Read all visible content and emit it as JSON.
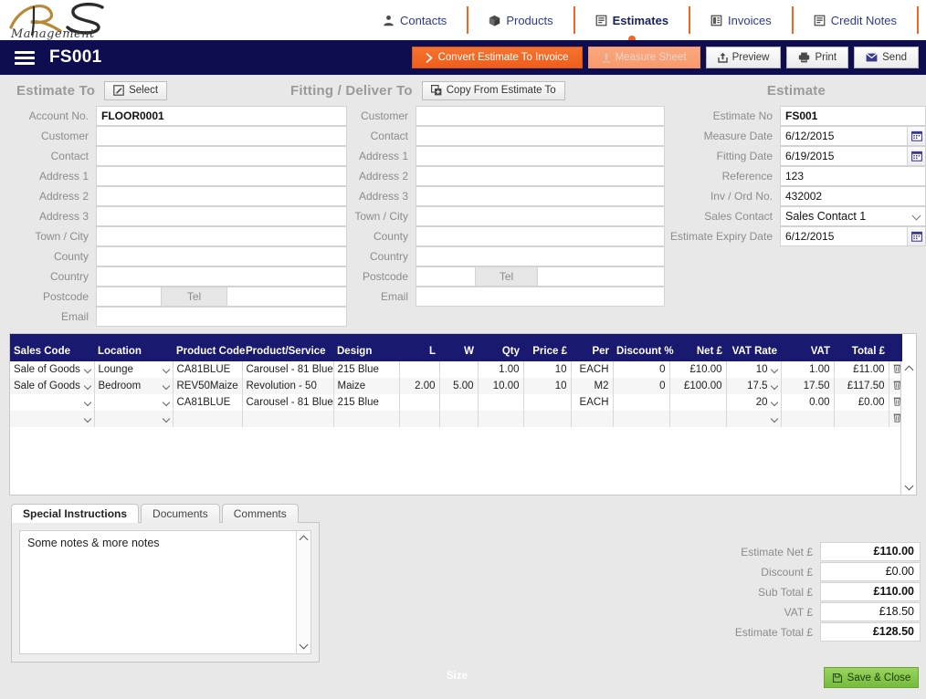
{
  "app": {
    "logo_text": "RS Management",
    "document_title": "FS001"
  },
  "nav": {
    "tabs": [
      {
        "label": "Contacts",
        "icon": "person-icon",
        "active": false
      },
      {
        "label": "Products",
        "icon": "box-icon",
        "active": false
      },
      {
        "label": "Estimates",
        "icon": "document-icon",
        "active": true
      },
      {
        "label": "Invoices",
        "icon": "invoice-icon",
        "active": false
      },
      {
        "label": "Credit Notes",
        "icon": "credit-note-icon",
        "active": false
      }
    ]
  },
  "toolbar": {
    "convert_label": "Convert Estimate To Invoice",
    "measure_label": "Measure Sheet",
    "preview_label": "Preview",
    "print_label": "Print",
    "send_label": "Send"
  },
  "estimate_to": {
    "title": "Estimate To",
    "select_label": "Select",
    "labels": {
      "account_no": "Account No.",
      "customer": "Customer",
      "contact": "Contact",
      "address1": "Address 1",
      "address2": "Address 2",
      "address3": "Address 3",
      "town_city": "Town / City",
      "county": "County",
      "country": "Country",
      "postcode": "Postcode",
      "tel": "Tel",
      "email": "Email"
    },
    "values": {
      "account_no": "FLOOR0001",
      "customer": "",
      "contact": "",
      "address1": "",
      "address2": "",
      "address3": "",
      "town_city": "",
      "county": "",
      "country": "",
      "postcode": "",
      "tel": "",
      "email": ""
    }
  },
  "fitting_to": {
    "title": "Fitting / Deliver To",
    "copy_label": "Copy From Estimate To",
    "labels": {
      "customer": "Customer",
      "contact": "Contact",
      "address1": "Address 1",
      "address2": "Address 2",
      "address3": "Address 3",
      "town_city": "Town / City",
      "county": "County",
      "country": "Country",
      "postcode": "Postcode",
      "tel": "Tel",
      "email": "Email"
    },
    "values": {
      "customer": "",
      "contact": "",
      "address1": "",
      "address2": "",
      "address3": "",
      "town_city": "",
      "county": "",
      "country": "",
      "postcode": "",
      "tel": "",
      "email": ""
    }
  },
  "estimate": {
    "title": "Estimate",
    "labels": {
      "estimate_no": "Estimate No",
      "measure_date": "Measure Date",
      "fitting_date": "Fitting Date",
      "reference": "Reference",
      "inv_ord_no": "Inv / Ord No.",
      "sales_contact": "Sales Contact",
      "expiry_date": "Estimate  Expiry Date"
    },
    "values": {
      "estimate_no": "FS001",
      "measure_date": "6/12/2015",
      "fitting_date": "6/19/2015",
      "reference": "123",
      "inv_ord_no": "432002",
      "sales_contact": "Sales Contact 1",
      "expiry_date": "6/12/2015"
    }
  },
  "grid": {
    "size_group_label": "Size",
    "columns": [
      "Sales Code",
      "Location",
      "Product Code",
      "Product/Service",
      "Design",
      "L",
      "W",
      "Qty",
      "Price £",
      "Per",
      "Discount %",
      "Net £",
      "VAT Rate",
      "VAT",
      "Total £"
    ],
    "rows": [
      {
        "sales_code": "Sale of Goods",
        "location": "Lounge",
        "product_code": "CA81BLUE",
        "product_service": "Carousel - 81 Blue",
        "design": "215 Blue",
        "l": "",
        "w": "",
        "qty": "1.00",
        "price": "10",
        "per": "EACH",
        "discount": "0",
        "net": "£10.00",
        "vat_rate": "10",
        "vat": "1.00",
        "total": "£11.00"
      },
      {
        "sales_code": "Sale of Goods",
        "location": "Bedroom",
        "product_code": "REV50Maize",
        "product_service": "Revolution - 50",
        "design": "Maize",
        "l": "2.00",
        "w": "5.00",
        "qty": "10.00",
        "price": "10",
        "per": "M2",
        "discount": "0",
        "net": "£100.00",
        "vat_rate": "17.5",
        "vat": "17.50",
        "total": "£117.50"
      },
      {
        "sales_code": "",
        "location": "",
        "product_code": "CA81BLUE",
        "product_service": "Carousel - 81 Blue",
        "design": "215 Blue",
        "l": "",
        "w": "",
        "qty": "",
        "price": "",
        "per": "EACH",
        "discount": "",
        "net": "",
        "vat_rate": "20",
        "vat": "0.00",
        "total": "£0.00"
      },
      {
        "sales_code": "",
        "location": "",
        "product_code": "",
        "product_service": "",
        "design": "",
        "l": "",
        "w": "",
        "qty": "",
        "price": "",
        "per": "",
        "discount": "",
        "net": "",
        "vat_rate": "",
        "vat": "",
        "total": ""
      }
    ]
  },
  "bottom_tabs": [
    {
      "label": "Special Instructions",
      "active": true
    },
    {
      "label": "Documents",
      "active": false
    },
    {
      "label": "Comments",
      "active": false
    }
  ],
  "notes": {
    "text": "Some notes & more notes"
  },
  "totals": {
    "rows": [
      {
        "label": "Estimate Net £",
        "value": "£110.00",
        "bold": true
      },
      {
        "label": "Discount £",
        "value": "£0.00",
        "bold": false
      },
      {
        "label": "Sub Total £",
        "value": "£110.00",
        "bold": true
      },
      {
        "label": "VAT £",
        "value": "£18.50",
        "bold": false
      },
      {
        "label": "Estimate Total £",
        "value": "£128.50",
        "bold": true
      }
    ]
  },
  "actions": {
    "save_close_label": "Save & Close"
  },
  "colors": {
    "navy": "#0d0d4f",
    "grid_header": "#191970",
    "orange": "#f26522",
    "page_bg": "#e8e8e8",
    "green": "#8ccb50",
    "link_blue": "#2b3b8f"
  }
}
